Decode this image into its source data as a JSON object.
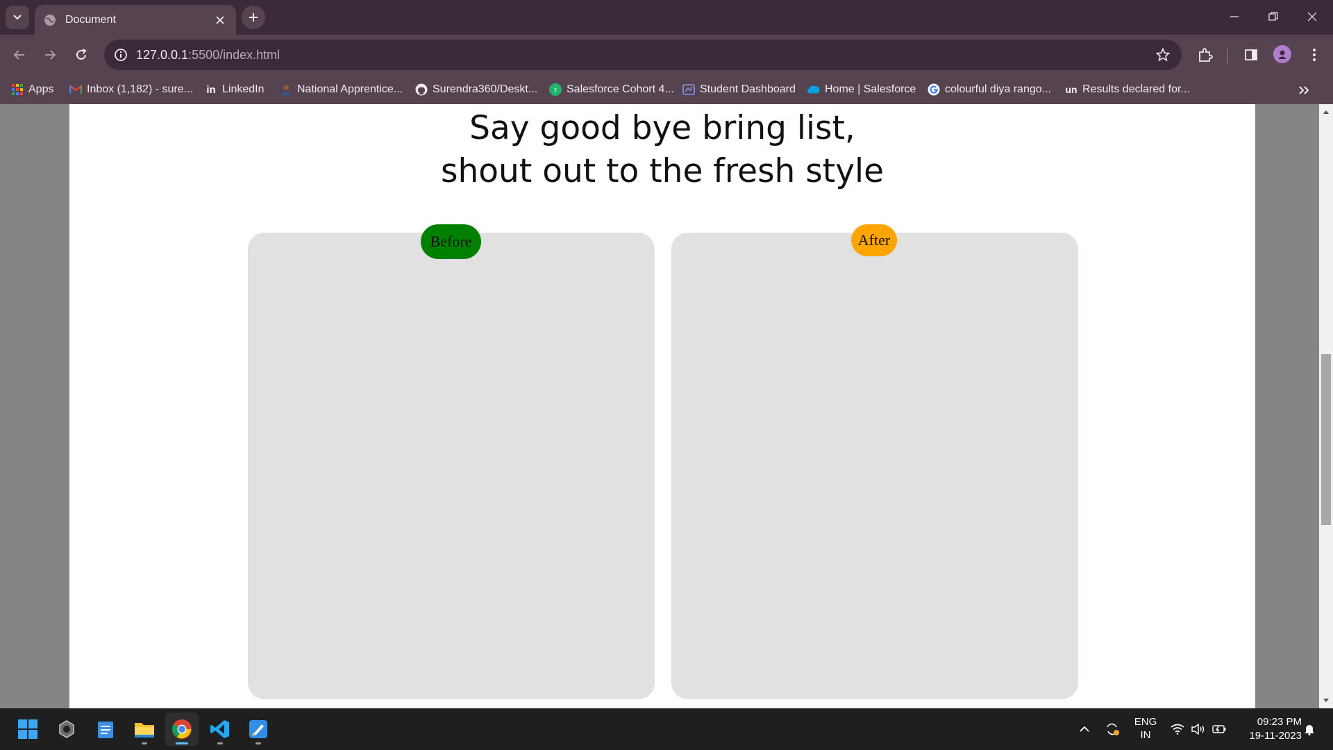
{
  "browser": {
    "tab": {
      "title": "Document"
    },
    "address": {
      "host": "127.0.0.1",
      "rest": ":5500/index.html"
    },
    "bookmarks": [
      {
        "label": "Apps",
        "icon": "apps-grid-icon"
      },
      {
        "label": "Inbox (1,182) - sure...",
        "icon": "gmail-icon"
      },
      {
        "label": "LinkedIn",
        "icon": "linkedin-icon"
      },
      {
        "label": "National Apprentice...",
        "icon": "apprentice-icon"
      },
      {
        "label": "Surendra360/Deskt...",
        "icon": "github-icon"
      },
      {
        "label": "Salesforce Cohort 4...",
        "icon": "cohort-icon"
      },
      {
        "label": "Student Dashboard",
        "icon": "dashboard-icon"
      },
      {
        "label": "Home | Salesforce",
        "icon": "salesforce-icon"
      },
      {
        "label": "colourful diya rango...",
        "icon": "google-icon"
      },
      {
        "label": "Results declared for...",
        "icon": "unstop-icon"
      }
    ]
  },
  "page": {
    "heading_line1": "Say good bye bring list,",
    "heading_line2": "shout out to the fresh style",
    "before_label": "Before",
    "after_label": "After",
    "colors": {
      "before_badge": "#008000",
      "after_badge": "#ffa500",
      "card": "#e1e1e1"
    }
  },
  "taskbar": {
    "apps": [
      "windows-start-icon",
      "settings-app-icon",
      "notepad-icon",
      "file-explorer-icon",
      "chrome-icon",
      "vscode-icon",
      "paint-icon"
    ],
    "lang_line1": "ENG",
    "lang_line2": "IN",
    "time": "09:23 PM",
    "date": "19-11-2023"
  }
}
